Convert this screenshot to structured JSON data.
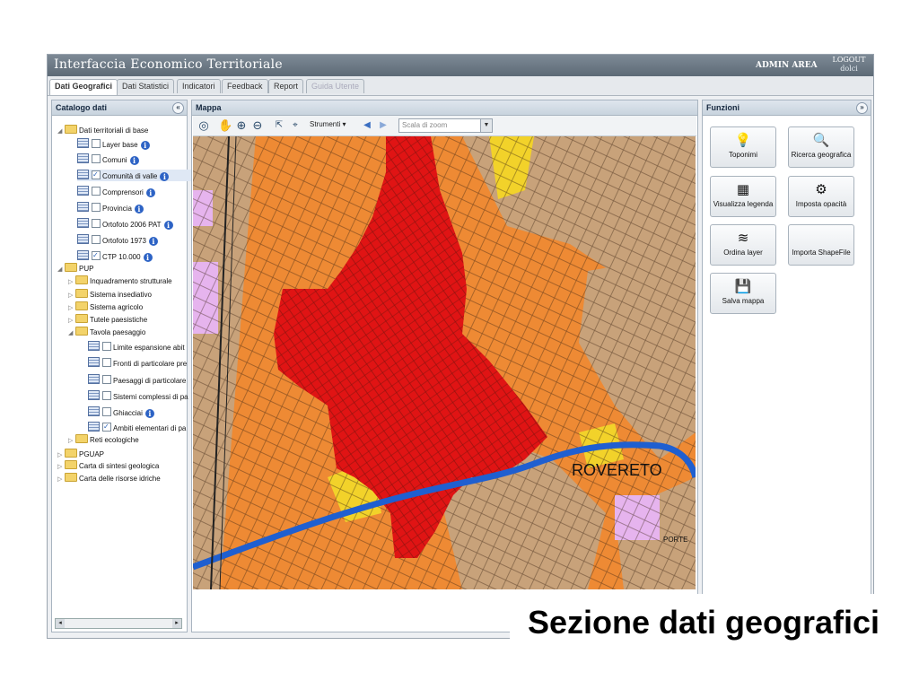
{
  "app": {
    "title": "Interfaccia Economico Territoriale",
    "admin_area": "ADMIN AREA",
    "logout": "LOGOUT",
    "user": "dolci"
  },
  "tabs": [
    "Dati Geografici",
    "Dati Statistici",
    "Indicatori",
    "Feedback",
    "Report",
    "Guida Utente"
  ],
  "catalog": {
    "title": "Catalogo dati",
    "collapse_icon": "double-chevron-left-icon",
    "items": [
      {
        "label": "Dati territoriali di base",
        "kind": "folder",
        "expanded": true
      },
      {
        "label": "Layer base",
        "kind": "layer",
        "checked": false,
        "info": true
      },
      {
        "label": "Comuni",
        "kind": "layer",
        "checked": false,
        "info": true
      },
      {
        "label": "Comunità di valle",
        "kind": "layer",
        "checked": true,
        "info": true
      },
      {
        "label": "Comprensori",
        "kind": "layer",
        "checked": false,
        "info": true
      },
      {
        "label": "Provincia",
        "kind": "layer",
        "checked": false,
        "info": true
      },
      {
        "label": "Ortofoto 2006 PAT",
        "kind": "layer",
        "checked": false,
        "info": true
      },
      {
        "label": "Ortofoto 1973",
        "kind": "layer",
        "checked": false,
        "info": true
      },
      {
        "label": "CTP 10.000",
        "kind": "layer",
        "checked": true,
        "info": true
      },
      {
        "label": "PUP",
        "kind": "folder",
        "expanded": true
      },
      {
        "label": "Inquadramento strutturale",
        "kind": "folder",
        "expanded": false
      },
      {
        "label": "Sistema insediativo",
        "kind": "folder",
        "expanded": false
      },
      {
        "label": "Sistema agricolo",
        "kind": "folder",
        "expanded": false
      },
      {
        "label": "Tutele paesistiche",
        "kind": "folder",
        "expanded": false
      },
      {
        "label": "Tavola paesaggio",
        "kind": "folder",
        "expanded": true
      },
      {
        "label": "Limite espansione abit",
        "kind": "layer",
        "checked": false,
        "info": false
      },
      {
        "label": "Fronti di particolare pre",
        "kind": "layer",
        "checked": false,
        "info": false
      },
      {
        "label": "Paesaggi di particolare",
        "kind": "layer",
        "checked": false,
        "info": false
      },
      {
        "label": "Sistemi complessi di pa",
        "kind": "layer",
        "checked": false,
        "info": false
      },
      {
        "label": "Ghiacciai",
        "kind": "layer",
        "checked": false,
        "info": true
      },
      {
        "label": "Ambiti elementari di pa",
        "kind": "layer",
        "checked": true,
        "info": false
      },
      {
        "label": "Reti ecologiche",
        "kind": "folder",
        "expanded": false
      },
      {
        "label": "PGUAP",
        "kind": "folder",
        "expanded": false
      },
      {
        "label": "Carta di sintesi geologica",
        "kind": "folder",
        "expanded": false
      },
      {
        "label": "Carta delle risorse idriche",
        "kind": "folder",
        "expanded": false
      }
    ]
  },
  "map_panel": {
    "title": "Mappa",
    "strumenti": "Strumenti",
    "scale_placeholder": "Scala di zoom",
    "place_label": "ROVERETO",
    "place_label_small": "PORTE",
    "colors": {
      "urban": "#e01414",
      "orange": "#ee8a34",
      "tan": "#c8a27a",
      "yellow": "#f2d22a",
      "river": "#1f5fd0",
      "violet": "#e6b4ee"
    }
  },
  "functions": {
    "title": "Funzioni",
    "expand_icon": "double-chevron-right-icon",
    "buttons": [
      {
        "label": "Toponimi",
        "icon": "bulb-icon"
      },
      {
        "label": "Ricerca geografica",
        "icon": "magnifier-icon"
      },
      {
        "label": "Visualizza legenda",
        "icon": "legend-icon"
      },
      {
        "label": "Imposta opacità",
        "icon": "opacity-icon"
      },
      {
        "label": "Ordina layer",
        "icon": "layers-icon"
      },
      {
        "label": "Importa ShapeFile",
        "icon": ""
      },
      {
        "label": "Salva mappa",
        "icon": "floppy-disk-icon"
      }
    ]
  },
  "caption": "Sezione dati geografici"
}
